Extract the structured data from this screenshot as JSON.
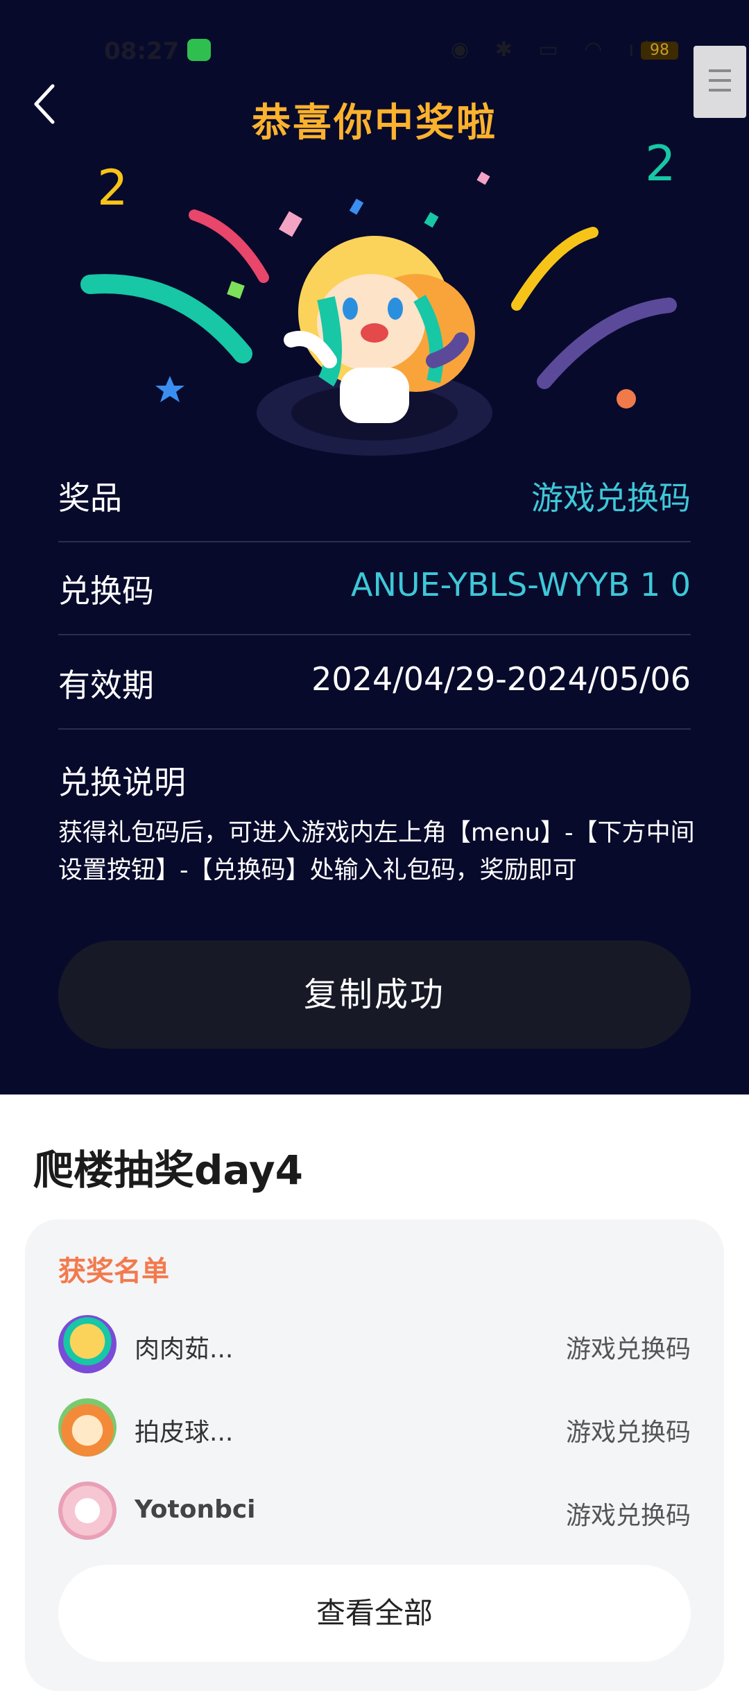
{
  "status_bar": {
    "time": "08:27",
    "battery": "98"
  },
  "header": {
    "title": "恭喜你中奖啦"
  },
  "prize_info": {
    "rows": [
      {
        "label": "奖品",
        "value": "游戏兑换码"
      },
      {
        "label": "兑换码",
        "value": "ANUE-YBLS-WYYB 1 0"
      },
      {
        "label": "有效期",
        "value": "2024/04/29-2024/05/06"
      }
    ],
    "instructions_title": "兑换说明",
    "instructions_text": "获得礼包码后，可进入游戏内左上角【menu】-【下方中间设置按钮】-【兑换码】处输入礼包码，奖励即可",
    "copy_button_label": "复制成功"
  },
  "event": {
    "section_title": "爬楼抽奖day4",
    "winners_title": "获奖名单",
    "winners": [
      {
        "name": "肉肉茹...",
        "prize": "游戏兑换码"
      },
      {
        "name": "拍皮球...",
        "prize": "游戏兑换码"
      },
      {
        "name": "Yotonbci",
        "prize": "游戏兑换码"
      }
    ],
    "view_all_label": "查看全部"
  },
  "colors": {
    "background_dark": "#080a2c",
    "title_gold": "#fbb22d",
    "accent_teal": "#3ec8d8",
    "winners_orange": "#f27a4d"
  }
}
